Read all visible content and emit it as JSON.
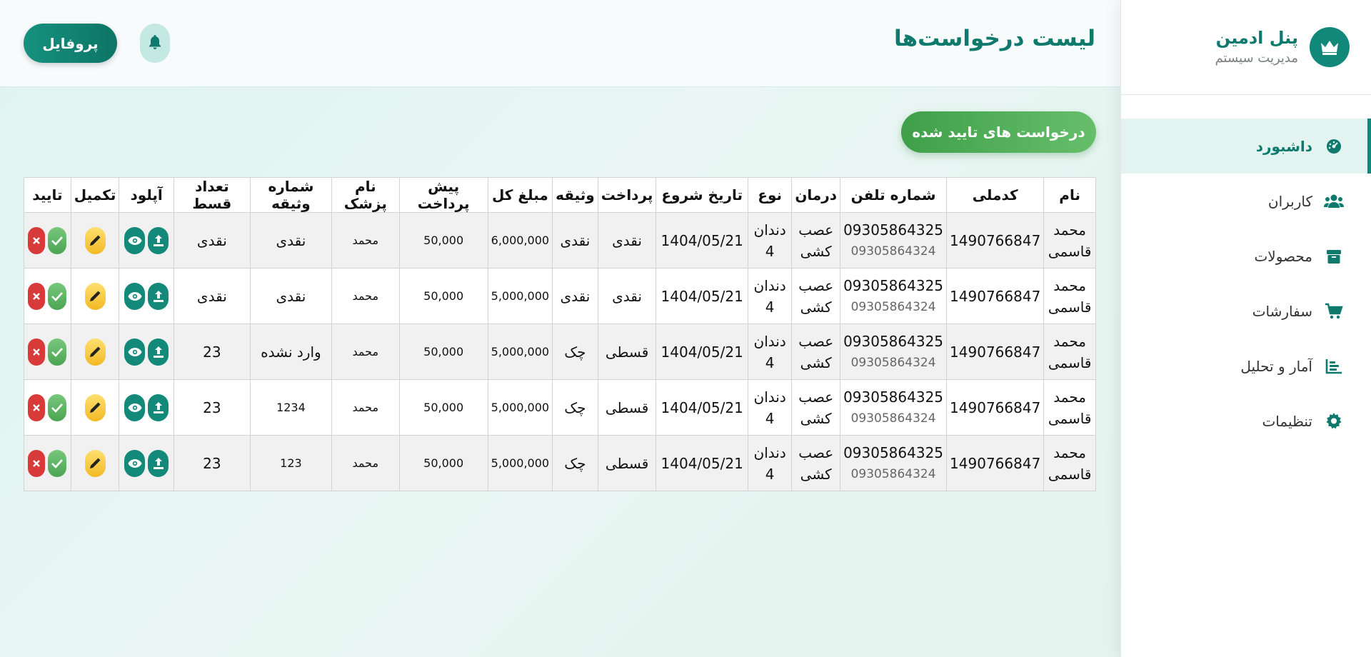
{
  "sidebar": {
    "brand_title": "پنل ادمین",
    "brand_subtitle": "مدیریت سیستم",
    "brand_icon": "crown-icon",
    "items": [
      {
        "label": "داشبورد",
        "icon": "dashboard-icon",
        "active": true
      },
      {
        "label": "کاربران",
        "icon": "users-icon",
        "active": false
      },
      {
        "label": "محصولات",
        "icon": "box-icon",
        "active": false
      },
      {
        "label": "سفارشات",
        "icon": "cart-icon",
        "active": false
      },
      {
        "label": "آمار و تحلیل",
        "icon": "chart-icon",
        "active": false
      },
      {
        "label": "تنظیمات",
        "icon": "gear-icon",
        "active": false
      }
    ]
  },
  "header": {
    "title": "لیست درخواست‌ها",
    "profile_label": "پروفایل",
    "bell_icon": "bell-icon"
  },
  "approved_button": "درخواست های تایید شده",
  "colors": {
    "primary": "#11887a",
    "approve": "#4ba552",
    "reject": "#d83a3a",
    "edit": "#f3b924"
  },
  "table": {
    "headers": [
      "نام",
      "کدملی",
      "شماره تلفن",
      "درمان",
      "نوع",
      "تاریخ شروع",
      "پرداخت",
      "وثیقه",
      "مبلغ کل",
      "پیش پرداخت",
      "نام پزشک",
      "شماره وثیقه",
      "تعداد قسط",
      "آپلود",
      "تکمیل",
      "تایید"
    ],
    "rows": [
      {
        "name": "محمد قاسمی",
        "national_id": "1490766847",
        "phone": "09305864325",
        "phone2": "09305864324",
        "treatment": "عصب کشی",
        "type": "دندان 4",
        "start_date": "1404/05/21",
        "payment": "نقدی",
        "collateral": "نقدی",
        "total": "6,000,000",
        "prepay": "50,000",
        "doctor": "محمد",
        "collateral_no": "نقدی",
        "installments": "نقدی"
      },
      {
        "name": "محمد قاسمی",
        "national_id": "1490766847",
        "phone": "09305864325",
        "phone2": "09305864324",
        "treatment": "عصب کشی",
        "type": "دندان 4",
        "start_date": "1404/05/21",
        "payment": "نقدی",
        "collateral": "نقدی",
        "total": "5,000,000",
        "prepay": "50,000",
        "doctor": "محمد",
        "collateral_no": "نقدی",
        "installments": "نقدی"
      },
      {
        "name": "محمد قاسمی",
        "national_id": "1490766847",
        "phone": "09305864325",
        "phone2": "09305864324",
        "treatment": "عصب کشی",
        "type": "دندان 4",
        "start_date": "1404/05/21",
        "payment": "قسطی",
        "collateral": "چک",
        "total": "5,000,000",
        "prepay": "50,000",
        "doctor": "محمد",
        "collateral_no": "وارد نشده",
        "installments": "23"
      },
      {
        "name": "محمد قاسمی",
        "national_id": "1490766847",
        "phone": "09305864325",
        "phone2": "09305864324",
        "treatment": "عصب کشی",
        "type": "دندان 4",
        "start_date": "1404/05/21",
        "payment": "قسطی",
        "collateral": "چک",
        "total": "5,000,000",
        "prepay": "50,000",
        "doctor": "محمد",
        "collateral_no": "1234",
        "installments": "23"
      },
      {
        "name": "محمد قاسمی",
        "national_id": "1490766847",
        "phone": "09305864325",
        "phone2": "09305864324",
        "treatment": "عصب کشی",
        "type": "دندان 4",
        "start_date": "1404/05/21",
        "payment": "قسطی",
        "collateral": "چک",
        "total": "5,000,000",
        "prepay": "50,000",
        "doctor": "محمد",
        "collateral_no": "123",
        "installments": "23"
      }
    ]
  }
}
